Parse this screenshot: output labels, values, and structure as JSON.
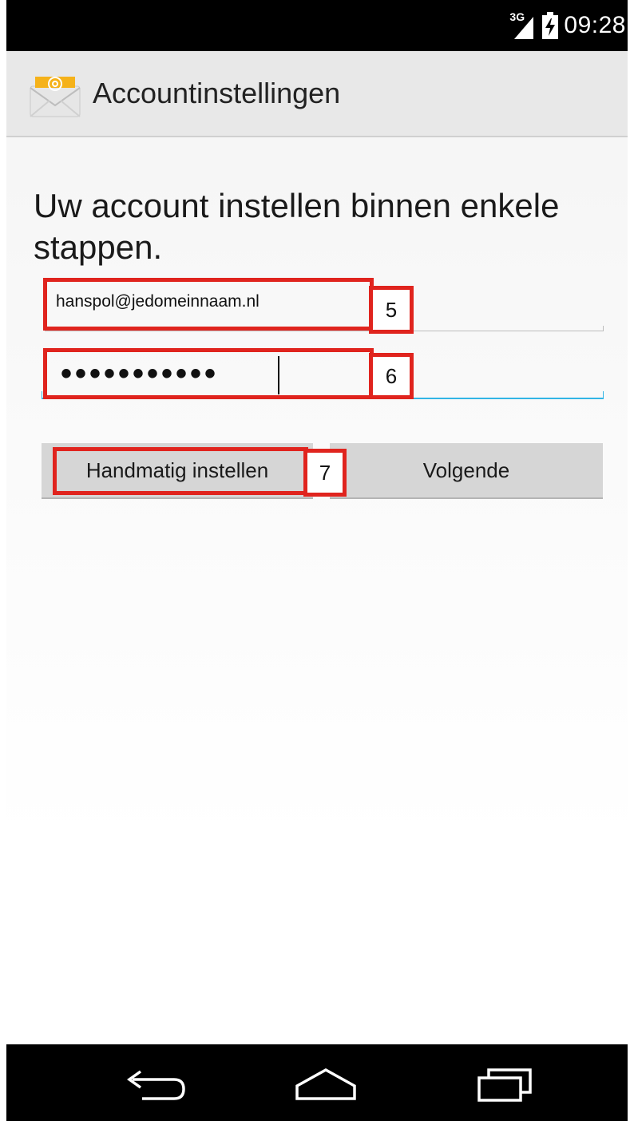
{
  "status_bar": {
    "network_label": "3G",
    "time": "09:28",
    "icons": [
      "signal-icon",
      "battery-icon"
    ]
  },
  "action_bar": {
    "app_icon": "email-app-icon",
    "title": "Accountinstellingen"
  },
  "main": {
    "heading": "Uw account instellen binnen enkele stappen.",
    "email": {
      "value": "hanspol@jedomeinnaam.nl"
    },
    "password": {
      "masked_value": "•••••••••••"
    },
    "buttons": {
      "manual_label": "Handmatig instellen",
      "next_label": "Volgende"
    }
  },
  "annotations": {
    "badge_email": "5",
    "badge_password": "6",
    "badge_manual": "7",
    "highlight_color": "#e0241e"
  },
  "nav_bar": {
    "icons": [
      "back-icon",
      "home-icon",
      "recent-apps-icon"
    ]
  },
  "colors": {
    "focus_accent": "#33b5e5",
    "status_bar_bg": "#000000",
    "action_bar_bg": "#e8e8e8"
  }
}
